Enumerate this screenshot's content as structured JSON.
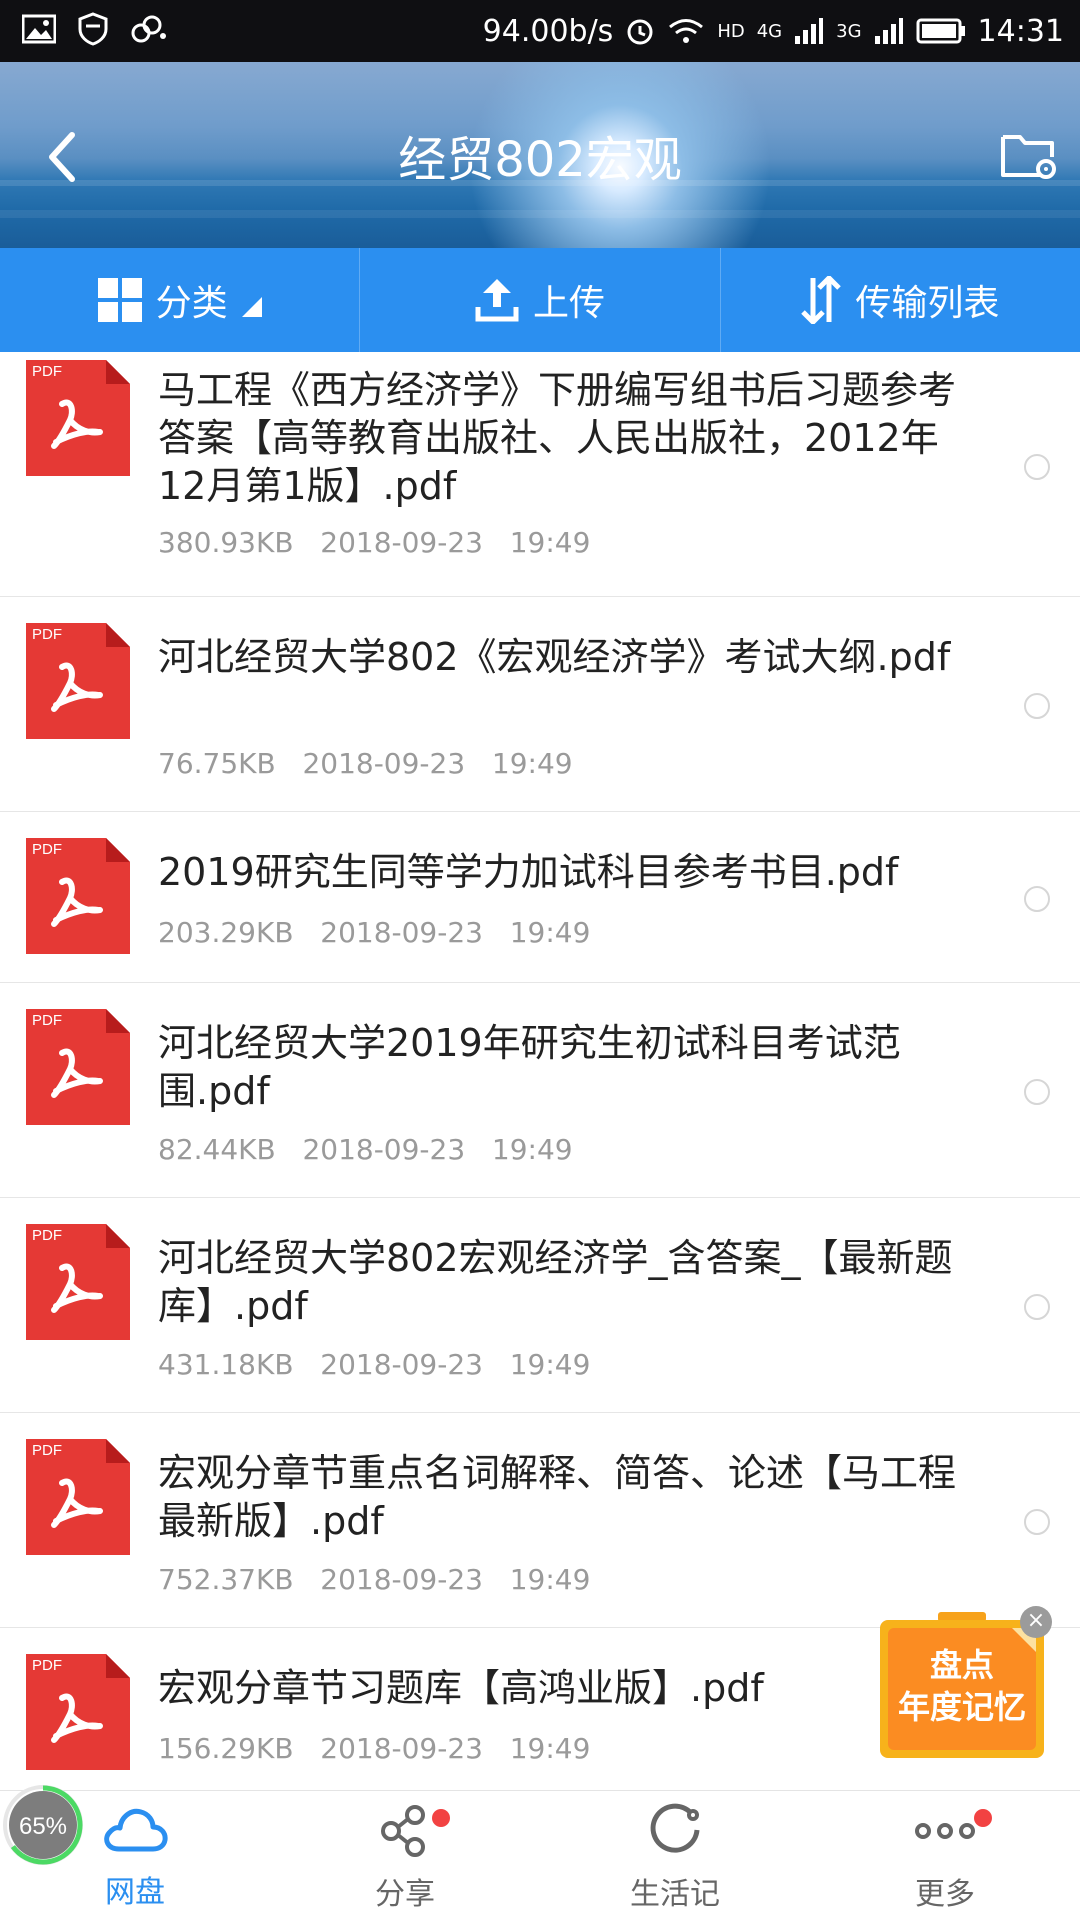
{
  "status_bar": {
    "speed": "94.00b/s",
    "net1": "4G",
    "net2": "3G",
    "hd": "HD",
    "time": "14:31"
  },
  "header": {
    "title": "经贸802宏观"
  },
  "toolbar": {
    "classify": "分类",
    "upload": "上传",
    "transfer": "传输列表"
  },
  "files": [
    {
      "name": "马工程《西方经济学》下册编写组书后习题参考答案【高等教育出版社、人民出版社，2012年12月第1版】.pdf",
      "size": "380.93KB",
      "date": "2018-09-23",
      "time": "19:49"
    },
    {
      "name": "河北经贸大学802《宏观经济学》考试大纲.pdf",
      "size": "76.75KB",
      "date": "2018-09-23",
      "time": "19:49"
    },
    {
      "name": "2019研究生同等学力加试科目参考书目.pdf",
      "size": "203.29KB",
      "date": "2018-09-23",
      "time": "19:49"
    },
    {
      "name": "河北经贸大学2019年研究生初试科目考试范围.pdf",
      "size": "82.44KB",
      "date": "2018-09-23",
      "time": "19:49"
    },
    {
      "name": "河北经贸大学802宏观经济学_含答案_【最新题库】.pdf",
      "size": "431.18KB",
      "date": "2018-09-23",
      "time": "19:49"
    },
    {
      "name": "宏观分章节重点名词解释、简答、论述【马工程最新版】.pdf",
      "size": "752.37KB",
      "date": "2018-09-23",
      "time": "19:49"
    },
    {
      "name": "宏观分章节习题库【高鸿业版】.pdf",
      "size": "156.29KB",
      "date": "2018-09-23",
      "time": "19:49"
    }
  ],
  "pdf_badge": "PDF",
  "promo": {
    "line1": "盘点",
    "line2": "年度记忆"
  },
  "progress": {
    "label": "65%",
    "value": 0.65
  },
  "tabs": [
    {
      "label": "网盘",
      "icon": "cloud-icon",
      "active": true
    },
    {
      "label": "分享",
      "icon": "share-icon",
      "active": false
    },
    {
      "label": "生活记",
      "icon": "life-record-icon",
      "active": false
    },
    {
      "label": "更多",
      "icon": "more-icon",
      "active": false
    }
  ],
  "colors": {
    "accent": "#2b8ff0",
    "pdf_red": "#e53935",
    "badge_red": "#f24242"
  }
}
